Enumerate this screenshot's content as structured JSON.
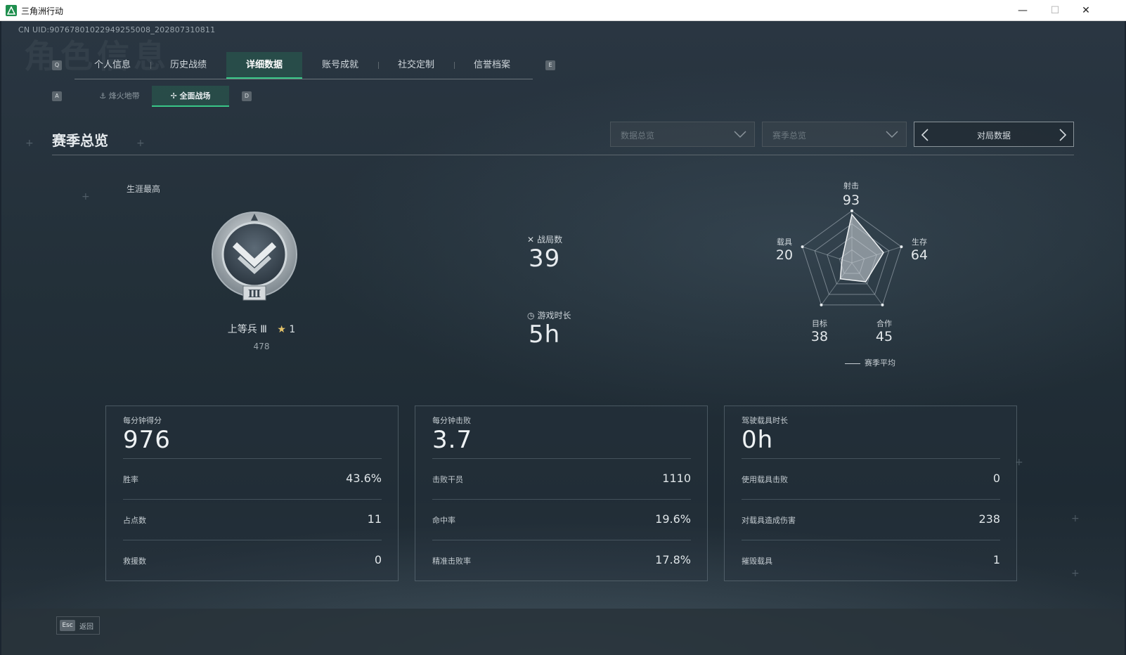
{
  "window": {
    "title": "三角洲行动",
    "minimize": "—",
    "maximize": "☐",
    "close": "✕"
  },
  "uid": "CN UID:9076780102294925500​8_202807310811",
  "ghost_title": "角色信息",
  "keys": {
    "prev_tab": "Q",
    "next_tab": "E",
    "prev_sub": "A",
    "next_sub": "D"
  },
  "tabs": [
    {
      "label": "个人信息"
    },
    {
      "label": "历史战绩"
    },
    {
      "label": "详细数据"
    },
    {
      "label": "账号成就"
    },
    {
      "label": "社交定制"
    },
    {
      "label": "信誉档案"
    }
  ],
  "subtabs": [
    {
      "label": "烽火地带"
    },
    {
      "label": "全面战场"
    }
  ],
  "section_title": "赛季总览",
  "dropdowns": [
    {
      "value": "数据总览"
    },
    {
      "value": "赛季总览"
    }
  ],
  "pager": {
    "label": "对局数据"
  },
  "rank": {
    "caption": "生涯最高",
    "name": "上等兵 Ⅲ",
    "stars": "1",
    "points": "478",
    "badge_numeral": "Ⅲ"
  },
  "summary": {
    "matches_label": "战局数",
    "matches_value": "39",
    "playtime_label": "游戏时长",
    "playtime_value": "5h"
  },
  "radar": {
    "axes": [
      {
        "label": "射击",
        "value": "93"
      },
      {
        "label": "生存",
        "value": "64"
      },
      {
        "label": "合作",
        "value": "45"
      },
      {
        "label": "目标",
        "value": "38"
      },
      {
        "label": "载具",
        "value": "20"
      }
    ],
    "legend": "赛季平均"
  },
  "cards": [
    {
      "head_label": "每分钟得分",
      "head_value": "976",
      "rows": [
        {
          "k": "胜率",
          "v": "43.6%"
        },
        {
          "k": "占点数",
          "v": "11"
        },
        {
          "k": "救援数",
          "v": "0"
        }
      ]
    },
    {
      "head_label": "每分钟击败",
      "head_value": "3.7",
      "rows": [
        {
          "k": "击败干员",
          "v": "1110"
        },
        {
          "k": "命中率",
          "v": "19.6%"
        },
        {
          "k": "精准击败率",
          "v": "17.8%"
        }
      ]
    },
    {
      "head_label": "驾驶载具时长",
      "head_value": "0h",
      "rows": [
        {
          "k": "使用载具击败",
          "v": "0"
        },
        {
          "k": "对载具造成伤害",
          "v": "238"
        },
        {
          "k": "摧毁载具",
          "v": "1"
        }
      ]
    }
  ],
  "footer": {
    "esc_key": "Esc",
    "esc_label": "返回"
  },
  "colors": {
    "accent": "#39c787",
    "tab_active_bg": "#285f50"
  }
}
